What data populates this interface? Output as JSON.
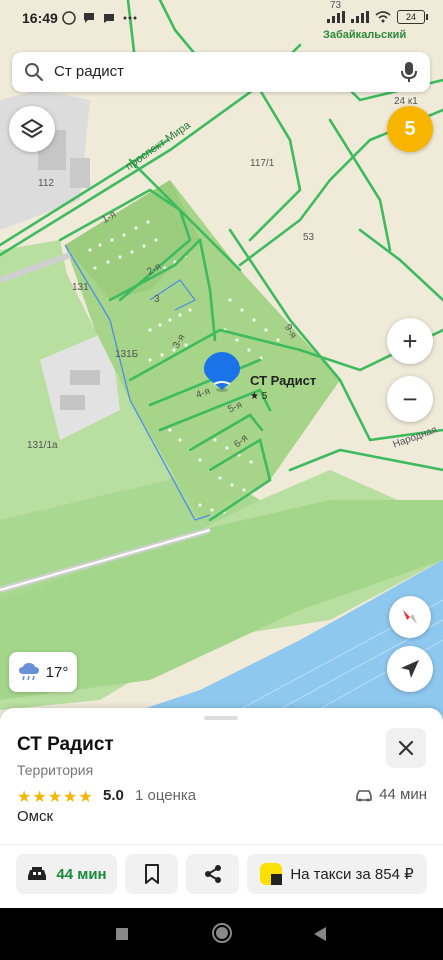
{
  "status_bar": {
    "time": "16:49",
    "battery": "24"
  },
  "map": {
    "district_label": "Забайкальский",
    "street_labels": [
      "проспект Мира",
      "1-я",
      "2-я",
      "3-я",
      "4-я",
      "5-я",
      "6-я",
      "9-я",
      "Народная"
    ],
    "house_numbers": [
      "112",
      "131",
      "3",
      "131Б",
      "131/1а",
      "117/1",
      "53",
      "24 к1",
      "73"
    ],
    "poi_name": "СТ Радист",
    "poi_rating": "★ 5",
    "layers_icon": "layers-icon",
    "badge": "5",
    "weather_temp": "17°",
    "zoom_in": "+",
    "zoom_out": "−"
  },
  "search": {
    "value": "Ст радист"
  },
  "card": {
    "title": "СТ Радист",
    "category": "Территория",
    "rating": "5.0",
    "reviews": "1 оценка",
    "drive_time": "44 мин",
    "city": "Омск",
    "actions": {
      "taxi_time": "44 мин",
      "taxi_price": "На такси за 854 ₽"
    }
  },
  "colors": {
    "accent_yellow": "#f7b500",
    "road_green": "#3dbb5e",
    "park_green": "#a6d488",
    "water": "#8ec8ef",
    "pin_blue": "#1a73e8"
  }
}
